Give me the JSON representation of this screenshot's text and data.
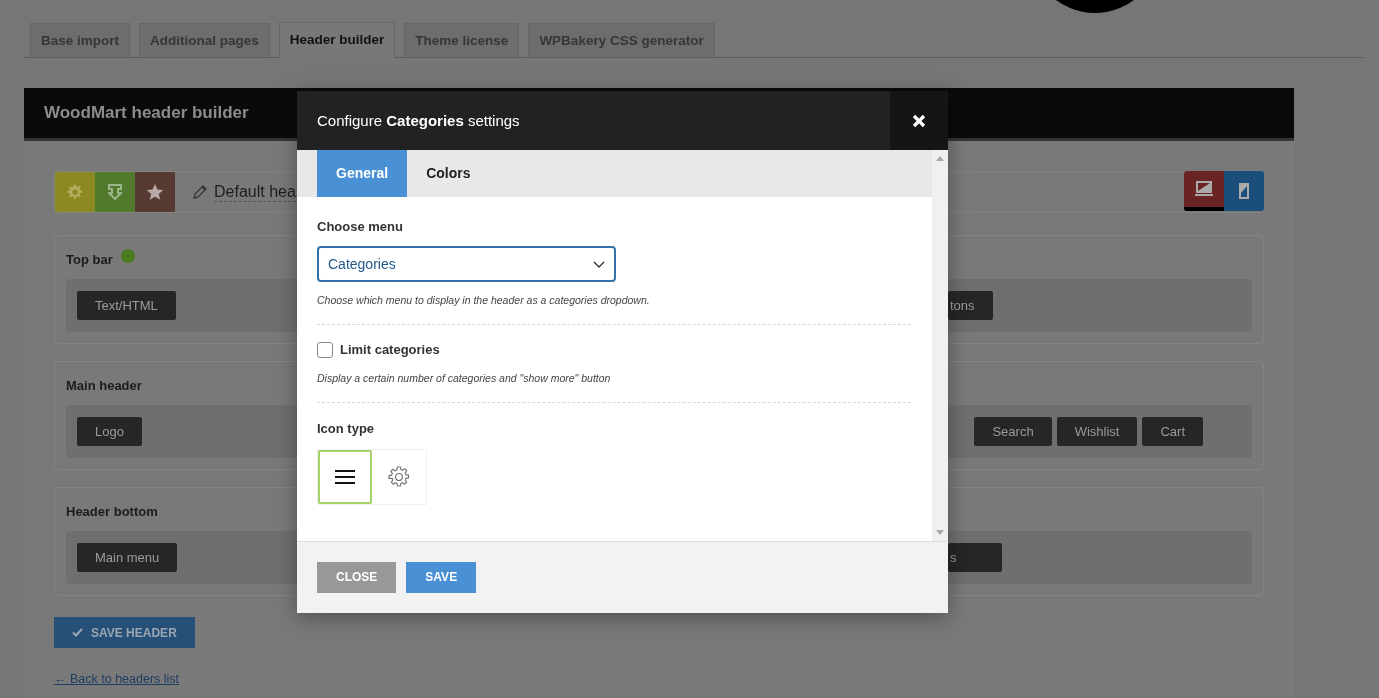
{
  "admin_tabs": [
    {
      "label": "Base import",
      "selected": false
    },
    {
      "label": "Additional pages",
      "selected": false
    },
    {
      "label": "Header builder",
      "selected": true
    },
    {
      "label": "Theme license",
      "selected": false
    },
    {
      "label": "WPBakery CSS generator",
      "selected": false
    }
  ],
  "builder": {
    "title": "WoodMart header builder",
    "header_name": "Default hea",
    "devices": [
      {
        "kind": "desktop",
        "selected": true
      },
      {
        "kind": "mobile",
        "selected": false
      }
    ],
    "sections": [
      {
        "title": "Top bar",
        "indicator": true,
        "left": [
          {
            "label": "Text/HTML"
          }
        ],
        "right": [
          {
            "label": "tons"
          }
        ]
      },
      {
        "title": "Main header",
        "indicator": false,
        "left": [
          {
            "label": "Logo"
          }
        ],
        "right": [
          {
            "label": "Search"
          },
          {
            "label": "Wishlist"
          },
          {
            "label": "Cart"
          }
        ]
      },
      {
        "title": "Header bottom",
        "indicator": false,
        "left": [
          {
            "label": "Main menu"
          }
        ],
        "right": [
          {
            "label": "s"
          }
        ]
      }
    ],
    "save_button": "SAVE HEADER",
    "back_link": "← Back to headers list"
  },
  "modal": {
    "title": "Configure **Categories** settings",
    "tabs": [
      {
        "label": "General",
        "selected": true
      },
      {
        "label": "Colors",
        "selected": false
      }
    ],
    "fields": [
      {
        "kind": "select",
        "label": "Choose menu",
        "value": "Categories",
        "description": "Choose which menu to display in the header as a categories dropdown."
      },
      {
        "kind": "checkbox",
        "label": "Limit categories",
        "checked": false,
        "description": "Display a certain number of categories and \"show more\" button"
      },
      {
        "kind": "icon_choice",
        "label": "Icon type",
        "options": [
          {
            "kind": "lines",
            "selected": true
          },
          {
            "kind": "gear",
            "selected": false
          }
        ]
      }
    ],
    "buttons": [
      {
        "kind": "close",
        "label": "CLOSE"
      },
      {
        "kind": "save",
        "label": "SAVE"
      }
    ]
  }
}
